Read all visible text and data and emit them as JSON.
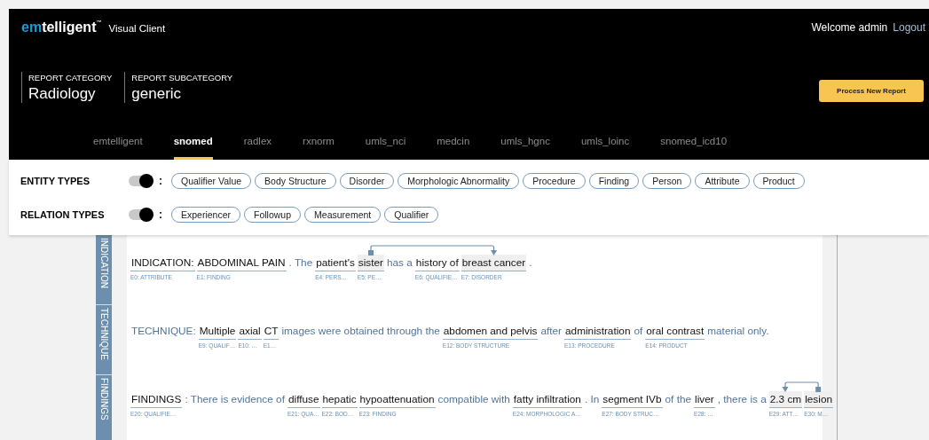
{
  "header": {
    "brand": {
      "accent": "em",
      "name": "telligent",
      "trademark": "™",
      "product": "Visual Client"
    },
    "welcome": "Welcome admin",
    "logout": "Logout"
  },
  "report": {
    "fields": [
      {
        "label": "REPORT CATEGORY",
        "value": "Radiology"
      },
      {
        "label": "REPORT SUBCATEGORY",
        "value": "generic"
      }
    ],
    "button": "Process New Report"
  },
  "tabs": [
    {
      "label": "emtelligent",
      "selected": false
    },
    {
      "label": "snomed",
      "selected": true
    },
    {
      "label": "radlex",
      "selected": false
    },
    {
      "label": "rxnorm",
      "selected": false
    },
    {
      "label": "umls_nci",
      "selected": false
    },
    {
      "label": "medcin",
      "selected": false
    },
    {
      "label": "umls_hgnc",
      "selected": false
    },
    {
      "label": "umls_loinc",
      "selected": false
    },
    {
      "label": "snomed_icd10",
      "selected": false
    }
  ],
  "filters": [
    {
      "label": "ENTITY TYPES",
      "on": true,
      "separator": ":",
      "chips": [
        "Qualifier Value",
        "Body Structure",
        "Disorder",
        "Morphologic Abnormality",
        "Procedure",
        "Finding",
        "Person",
        "Attribute",
        "Product"
      ]
    },
    {
      "label": "RELATION TYPES",
      "on": true,
      "separator": ":",
      "chips": [
        "Experiencer",
        "Followup",
        "Measurement",
        "Qualifier"
      ]
    }
  ],
  "sections": [
    {
      "tab": "INDICATION",
      "segments": [
        {
          "kind": "entity",
          "text": "INDICATION:",
          "label": "E0: ATTRIBUTE",
          "highlighted": false
        },
        {
          "kind": "entity",
          "text": "ABDOMINAL PAIN",
          "label": "E1: FINDING",
          "highlighted": false
        },
        {
          "kind": "text",
          "text": ". The"
        },
        {
          "kind": "entity",
          "text": "patient's",
          "label": "E4: PERS…",
          "highlighted": false
        },
        {
          "kind": "entity",
          "text": "sister",
          "label": "E5: PE…",
          "highlighted": true,
          "relation_start": true,
          "relation_end": false
        },
        {
          "kind": "text",
          "text": "has a"
        },
        {
          "kind": "entity",
          "text": "history of",
          "label": "E6: QUALIFIE…",
          "highlighted": false
        },
        {
          "kind": "entity",
          "text": "breast cancer",
          "label": "E7: DISORDER",
          "highlighted": true,
          "relation_start": false,
          "relation_end": true
        },
        {
          "kind": "text",
          "text": "."
        }
      ]
    },
    {
      "tab": "TECHNIQUE",
      "segments": [
        {
          "kind": "text",
          "text": "TECHNIQUE:"
        },
        {
          "kind": "entity",
          "text": "Multiple",
          "label": "E9: QUALIF…",
          "highlighted": false
        },
        {
          "kind": "entity",
          "text": "axial",
          "label": "E10: …",
          "highlighted": false
        },
        {
          "kind": "entity",
          "text": "CT",
          "label": "E1…",
          "highlighted": false
        },
        {
          "kind": "text",
          "text": "images were obtained through the"
        },
        {
          "kind": "entity",
          "text": "abdomen and pelvis",
          "label": "E12: BODY STRUCTURE",
          "highlighted": false
        },
        {
          "kind": "text",
          "text": "after"
        },
        {
          "kind": "entity",
          "text": "administration",
          "label": "E13: PROCEDURE",
          "highlighted": false
        },
        {
          "kind": "text",
          "text": "of"
        },
        {
          "kind": "entity",
          "text": "oral contrast",
          "label": "E14: PRODUCT",
          "highlighted": false
        },
        {
          "kind": "text",
          "text": "material only."
        }
      ]
    },
    {
      "tab": "FINDINGS",
      "segments": [
        {
          "kind": "entity",
          "text": "FINDINGS",
          "label": "E20: QUALIFIE…",
          "highlighted": false
        },
        {
          "kind": "text",
          "text": ": There is evidence of"
        },
        {
          "kind": "entity",
          "text": "diffuse",
          "label": "E21: QUA…",
          "highlighted": false
        },
        {
          "kind": "entity",
          "text": "hepatic",
          "label": "E22: BOD…",
          "highlighted": false
        },
        {
          "kind": "entity",
          "text": "hypoattenuation",
          "label": "E23: FINDING",
          "highlighted": false
        },
        {
          "kind": "text",
          "text": "compatible with"
        },
        {
          "kind": "entity",
          "text": "fatty infiltration",
          "label": "E24: MORPHOLOGIC A…",
          "highlighted": false
        },
        {
          "kind": "text",
          "text": ". In"
        },
        {
          "kind": "entity",
          "text": "segment IVb",
          "label": "E27: BODY STRUC…",
          "highlighted": false
        },
        {
          "kind": "text",
          "text": "of the"
        },
        {
          "kind": "entity",
          "text": "liver",
          "label": "E28: …",
          "highlighted": false
        },
        {
          "kind": "text",
          "text": ", there is a"
        },
        {
          "kind": "entity",
          "text": "2.3 cm",
          "label": "E29: ATT…",
          "highlighted": true,
          "relation_start": false,
          "relation_end": true
        },
        {
          "kind": "entity",
          "text": "lesion",
          "label": "E30: M…",
          "highlighted": true,
          "relation_start": true,
          "relation_end": false
        }
      ]
    }
  ]
}
